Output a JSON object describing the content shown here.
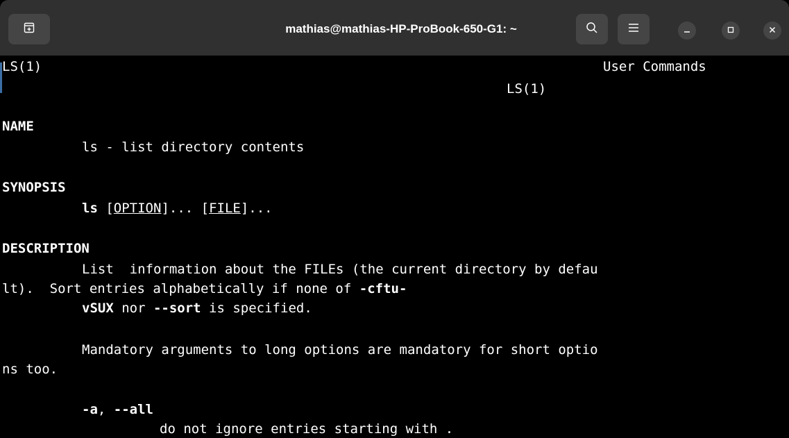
{
  "window": {
    "title": "mathias@mathias-HP-ProBook-650-G1: ~"
  },
  "icons": {
    "new_tab": "new-tab-icon",
    "search": "search-icon",
    "menu": "hamburger-menu-icon",
    "minimize": "minimize-icon",
    "maximize": "maximize-icon",
    "close": "close-icon"
  },
  "terminal": {
    "header_left": "LS(1)",
    "header_center": "User Commands",
    "header_right": "LS(1)",
    "name_heading": "NAME",
    "name_text": "ls - list directory contents",
    "synopsis_heading": "SYNOPSIS",
    "synopsis_cmd": "ls",
    "synopsis_open1": "[",
    "synopsis_option": "OPTION",
    "synopsis_mid": "]... [",
    "synopsis_file": "FILE",
    "synopsis_end": "]...",
    "description_heading": "DESCRIPTION",
    "desc_line1": "List  information about the FILEs (the current directory by defau",
    "desc_line2_pre": "lt).  Sort entries alphabetically if none of ",
    "desc_line2_bold": "-cftu-",
    "desc_line3_bold1": "vSUX",
    "desc_line3_mid": " nor ",
    "desc_line3_bold2": "--sort",
    "desc_line3_end": " is specified.",
    "mandatory_line1": "Mandatory arguments to long options are mandatory for short optio",
    "mandatory_line2": "ns too.",
    "opt_a_short": "-a",
    "opt_a_sep": ", ",
    "opt_a_long": "--all",
    "opt_a_desc": "do not ignore entries starting with ."
  },
  "colors": {
    "titlebar": "#303030",
    "button": "#454545",
    "terminal_bg": "#000000",
    "terminal_fg": "#ffffff"
  }
}
